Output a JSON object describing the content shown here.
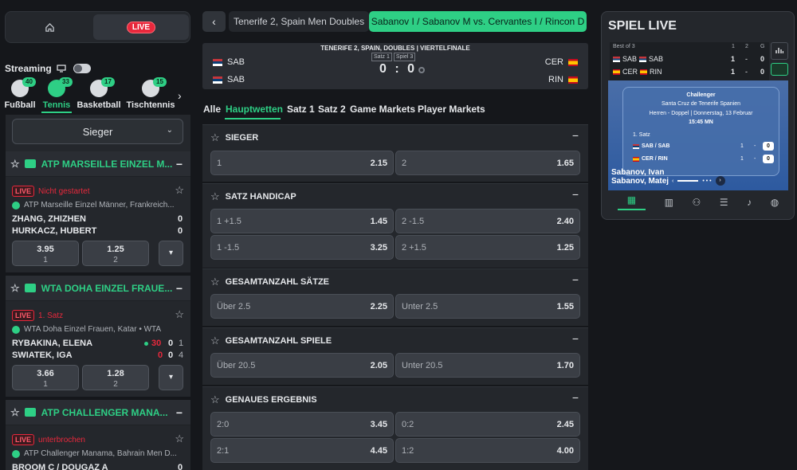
{
  "nav": {
    "home_icon": "home-icon",
    "live_label": "LIVE"
  },
  "streaming": {
    "label": "Streaming",
    "icon": "monitor-icon"
  },
  "sports": [
    {
      "label": "Fußball",
      "count": "40"
    },
    {
      "label": "Tennis",
      "count": "33"
    },
    {
      "label": "Basketball",
      "count": "17"
    },
    {
      "label": "Tischtennis",
      "count": "15"
    }
  ],
  "filter": {
    "selected": "Sieger"
  },
  "competitions": [
    {
      "name": "ATP MARSEILLE EINZEL M...",
      "minus": "−"
    },
    {
      "name": "WTA DOHA EINZEL FRAUE...",
      "minus": "−"
    },
    {
      "name": "ATP CHALLENGER MANA...",
      "minus": "−"
    }
  ],
  "matches": [
    {
      "live": "LIVE",
      "status": "Nicht gestartet",
      "league": "ATP Marseille Einzel Männer, Frankreich...",
      "team1": "ZHANG, ZHIZHEN",
      "team2": "HURKACZ, HUBERT",
      "s1": "0",
      "s2": "0",
      "odd1": "3.95",
      "lbl1": "1",
      "odd2": "1.25",
      "lbl2": "2"
    },
    {
      "live": "LIVE",
      "status": "1. Satz",
      "league": "WTA Doha Einzel Frauen, Katar • WTA",
      "team1": "RYBAKINA, ELENA",
      "team2": "SWIATEK, IGA",
      "p1": "30",
      "g1": "0",
      "set1": "1",
      "p2": "0",
      "g2": "0",
      "set2": "4",
      "odd1": "3.66",
      "lbl1": "1",
      "odd2": "1.28",
      "lbl2": "2"
    },
    {
      "live": "LIVE",
      "status": "unterbrochen",
      "league": "ATP Challenger Manama, Bahrain Men D...",
      "team1": "BROOM C / DOUGAZ A",
      "s1": "0"
    }
  ],
  "breadcrumb": {
    "back": "‹",
    "item1": "Tenerife 2, Spain Men Doubles",
    "item2": "Sabanov I / Sabanov M vs. Cervantes I / Rincon D"
  },
  "scoreboard": {
    "title": "TENERIFE 2, SPAIN, DOUBLES | VIERTELFINALE",
    "set1": "Satz 1",
    "set3": "Spiel 3",
    "home1": "SAB",
    "home2": "SAB",
    "away1": "CER",
    "away2": "RIN",
    "score": "0 : 0"
  },
  "tabs": [
    "Alle",
    "Hauptwetten",
    "Satz 1",
    "Satz 2",
    "Game Markets",
    "Player Markets"
  ],
  "markets": [
    {
      "title": "SIEGER",
      "rows": [
        [
          {
            "l": "1",
            "v": "2.15"
          },
          {
            "l": "2",
            "v": "1.65"
          }
        ]
      ]
    },
    {
      "title": "SATZ HANDICAP",
      "rows": [
        [
          {
            "l": "1 +1.5",
            "v": "1.45"
          },
          {
            "l": "2 -1.5",
            "v": "2.40"
          }
        ],
        [
          {
            "l": "1 -1.5",
            "v": "3.25"
          },
          {
            "l": "2 +1.5",
            "v": "1.25"
          }
        ]
      ]
    },
    {
      "title": "GESAMTANZAHL SÄTZE",
      "rows": [
        [
          {
            "l": "Über 2.5",
            "v": "2.25"
          },
          {
            "l": "Unter 2.5",
            "v": "1.55"
          }
        ]
      ]
    },
    {
      "title": "GESAMTANZAHL SPIELE",
      "rows": [
        [
          {
            "l": "Über 20.5",
            "v": "2.05"
          },
          {
            "l": "Unter 20.5",
            "v": "1.70"
          }
        ]
      ]
    },
    {
      "title": "GENAUES ERGEBNIS",
      "rows": [
        [
          {
            "l": "2:0",
            "v": "3.45"
          },
          {
            "l": "0:2",
            "v": "2.45"
          }
        ],
        [
          {
            "l": "2:1",
            "v": "4.45"
          },
          {
            "l": "1:2",
            "v": "4.00"
          }
        ]
      ]
    }
  ],
  "live_panel": {
    "title": "SPIEL LIVE",
    "best_of": "Best of 3",
    "c1": "1",
    "c2": "2",
    "cg": "G",
    "r1": {
      "a": "SAB",
      "b": "SAB",
      "s1": "1",
      "d": "-",
      "g": "0"
    },
    "r2": {
      "a": "CER",
      "b": "RIN",
      "s1": "1",
      "d": "-",
      "g": "0"
    },
    "card_l1": "Challenger",
    "card_l2": "Santa Cruz de Tenerife Spanien",
    "card_l3": "Herren - Doppel | Donnerstag, 13 Februar",
    "card_l4": "15:45 MN",
    "card_set": "1. Satz",
    "card_r1": {
      "name": "SAB / SAB",
      "s": "1",
      "d": "-",
      "b": "0"
    },
    "card_r2": {
      "name": "CER / RIN",
      "s": "1",
      "d": "-",
      "b": "0"
    },
    "names": "Sabanov, Ivan\nSabanov, Matej"
  }
}
